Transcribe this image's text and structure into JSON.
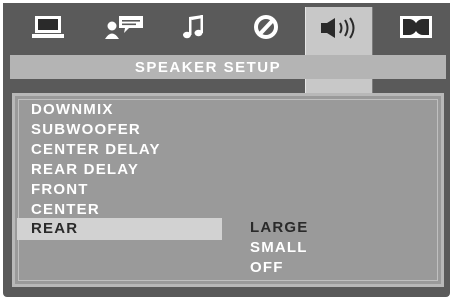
{
  "tabs": [
    {
      "icon": "monitor-icon"
    },
    {
      "icon": "person-subtitle-icon"
    },
    {
      "icon": "music-note-icon"
    },
    {
      "icon": "disc-icon"
    },
    {
      "icon": "speaker-icon"
    },
    {
      "icon": "dolby-icon"
    }
  ],
  "title": "SPEAKER SETUP",
  "menu": [
    "DOWNMIX",
    "SUBWOOFER",
    "CENTER DELAY",
    "REAR DELAY",
    "FRONT",
    "CENTER",
    "REAR"
  ],
  "options": [
    "LARGE",
    "SMALL",
    "OFF"
  ],
  "colors": {
    "background": "#5a5a5a",
    "panel": "#9a9a9a",
    "highlight": "#d2d2d2",
    "text": "#ffffff",
    "selected_text": "#2a2a2a"
  }
}
